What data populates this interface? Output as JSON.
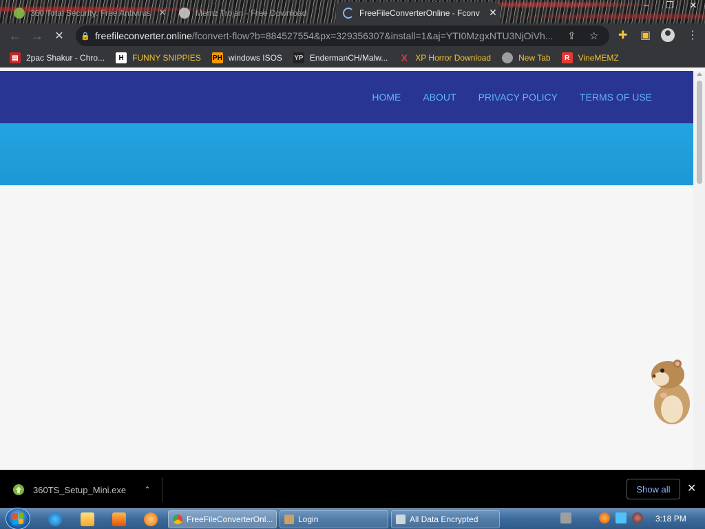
{
  "browser": {
    "tabs": [
      {
        "title": "360 Total Security: Free Antivirus",
        "state": "inactive",
        "favicon_color": "#8bc34a"
      },
      {
        "title": "Memz Trojan - Free Download",
        "state": "inactive",
        "favicon_color": "#d0d0d0"
      },
      {
        "title": "FreeFileConverterOnline - Fconv",
        "state": "active",
        "favicon": "loading-spinner"
      }
    ],
    "window_controls": [
      "–",
      "❐",
      "✕"
    ],
    "url": {
      "domain": "freefileconverter.online",
      "path": "/fconvert-flow?b=884527554&px=329356307&install=1&aj=YTI0MzgxNTU3NjOiVh..."
    },
    "bookmarks": [
      {
        "label": "2pac Shakur - Chro...",
        "icon": "H-icon-tupac",
        "icon_color": "#c62828"
      },
      {
        "label": "FUNNY SNIPPIES",
        "icon": "H",
        "icon_color": "#ffffff"
      },
      {
        "label": "windows ISOS",
        "icon": "PH",
        "icon_color": "#ff9800"
      },
      {
        "label": "EndermanCH/Malw...",
        "icon": "YP",
        "icon_color": "#cccccc"
      },
      {
        "label": "XP Horror Download",
        "icon": "X",
        "icon_color": "#e53935"
      },
      {
        "label": "New Tab",
        "icon": "globe",
        "icon_color": "#9e9e9e"
      },
      {
        "label": "VineMEMZ",
        "icon": "R",
        "icon_color": "#e53935"
      }
    ]
  },
  "site": {
    "nav": [
      "HOME",
      "ABOUT",
      "PRIVACY POLICY",
      "TERMS OF USE"
    ],
    "header_color": "#283593",
    "hero_color": "#23a4e0",
    "link_color": "#64b5f6"
  },
  "downloads": {
    "file_name": "360TS_Setup_Mini.exe",
    "show_all_label": "Show all"
  },
  "taskbar": {
    "buttons": [
      {
        "label": "FreeFileConverterOnl...",
        "icon": "chrome-icon",
        "active": true
      },
      {
        "label": "Login",
        "icon": "user-icon",
        "active": false
      },
      {
        "label": "All Data Encrypted",
        "icon": "window-icon",
        "active": false
      }
    ],
    "clock": "3:18 PM"
  }
}
